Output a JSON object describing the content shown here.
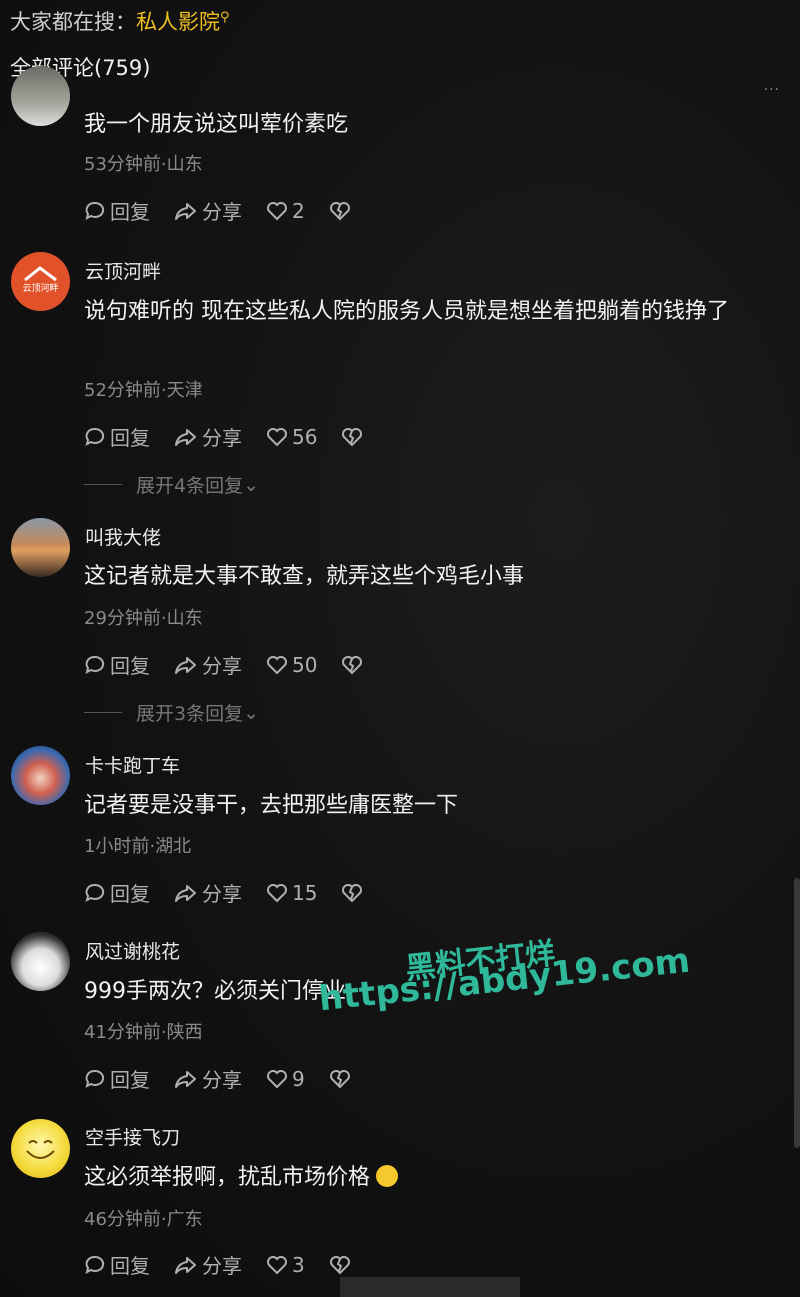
{
  "search": {
    "prefix": "大家都在搜：",
    "term": "私人影院"
  },
  "comments_header": {
    "label": "全部评论(759)"
  },
  "more_dots": "···",
  "actions": {
    "reply": "回复",
    "share": "分享"
  },
  "comments": [
    {
      "name": "",
      "text": "我一个朋友说这叫荤价素吃",
      "meta": "53分钟前·山东",
      "likes": "2",
      "expand": ""
    },
    {
      "name": "云顶河畔",
      "text": "说句难听的 现在这些私人院的服务人员就是想坐着把躺着的钱挣了",
      "meta": "52分钟前·天津",
      "likes": "56",
      "expand": "展开4条回复"
    },
    {
      "name": "叫我大佬",
      "text": "这记者就是大事不敢查，就弄这些个鸡毛小事",
      "meta": "29分钟前·山东",
      "likes": "50",
      "expand": "展开3条回复"
    },
    {
      "name": "卡卡跑丁车",
      "text": "记者要是没事干，去把那些庸医整一下",
      "meta": "1小时前·湖北",
      "likes": "15",
      "expand": ""
    },
    {
      "name": "风过谢桃花",
      "text": "999手两次？必须关门停业",
      "meta": "41分钟前·陕西",
      "likes": "9",
      "expand": ""
    },
    {
      "name": "空手接飞刀",
      "text": "这必须举报啊，扰乱市场价格",
      "meta": "46分钟前·广东",
      "likes": "3",
      "expand": ""
    }
  ],
  "avatar_logo_text": "云顶河畔",
  "watermark": {
    "line1": "黑料不打烊",
    "line2": "https://abdy19.com"
  },
  "colors": {
    "highlight": "#f0c020",
    "watermark": "#2fb89a",
    "background": "#121212"
  }
}
